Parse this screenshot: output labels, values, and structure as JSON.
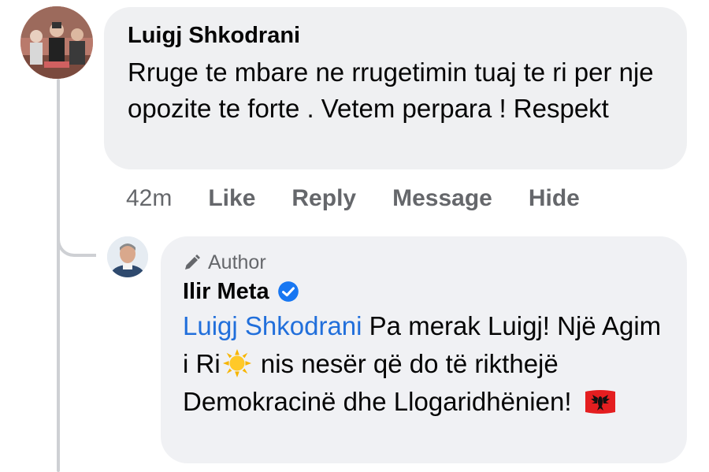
{
  "comment": {
    "author": "Luigj Shkodrani",
    "text": "Rruge te mbare ne rrugetimin tuaj te ri per nje opozite te forte . Vetem perpara ! Respekt",
    "time": "42m",
    "actions": [
      "Like",
      "Reply",
      "Message",
      "Hide"
    ]
  },
  "reply": {
    "badge": "Author",
    "author": "Ilir Meta",
    "mention": "Luigj Shkodrani",
    "text_part1": " Pa merak Luigj! Një Agim i Ri",
    "text_part2": " nis nesër që do të rikthejë Demokracinë dhe Llogaridhënien! "
  },
  "icons": {
    "author_badge": "pencil-icon",
    "verified": "verified-badge-icon",
    "sun": "sun-emoji-icon",
    "flag": "albania-flag-icon"
  },
  "colors": {
    "bubble": "#eff0f2",
    "mention": "#216fdb",
    "meta": "#65676b",
    "verified": "#1877f2",
    "flag_red": "#e41e20"
  }
}
